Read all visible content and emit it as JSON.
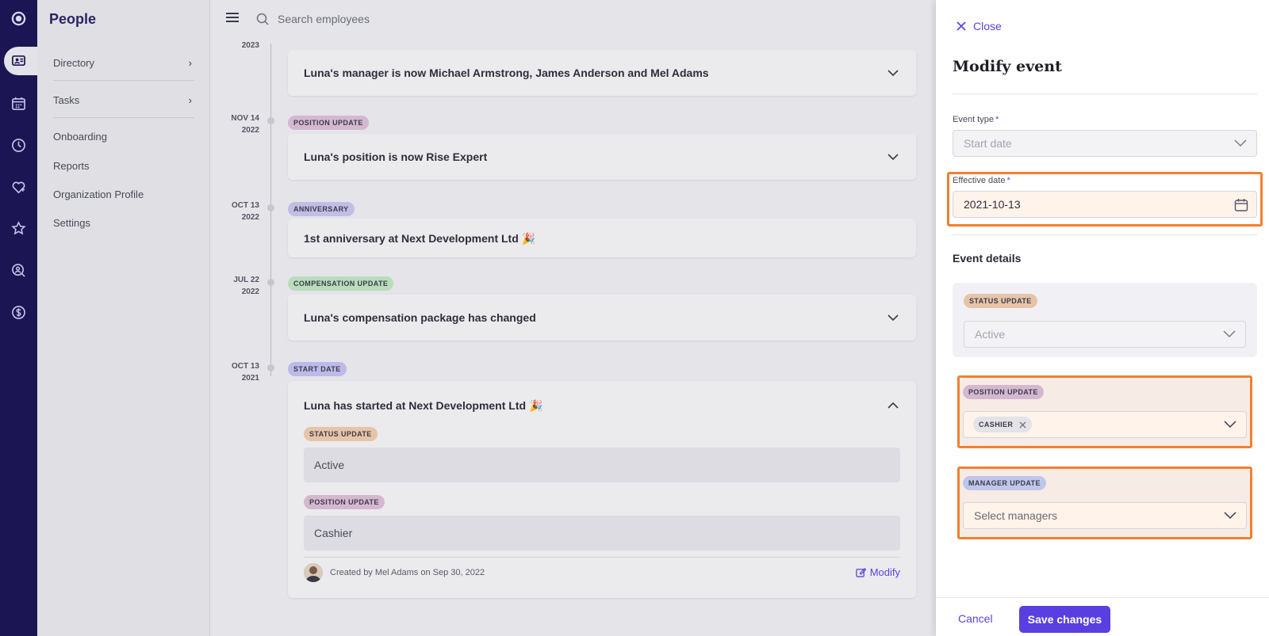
{
  "app": {
    "title": "People"
  },
  "rail": {
    "icons": [
      "logo-icon",
      "people-icon",
      "calendar-icon",
      "clock-icon",
      "heart-icon",
      "star-icon",
      "search-person-icon",
      "dollar-icon"
    ]
  },
  "sidebar": {
    "items": [
      {
        "label": "Directory",
        "has_arrow": true
      },
      {
        "label": "Tasks",
        "has_arrow": true
      },
      {
        "label": "Onboarding"
      },
      {
        "label": "Reports"
      },
      {
        "label": "Organization Profile"
      },
      {
        "label": "Settings"
      }
    ]
  },
  "search": {
    "placeholder": "Search employees"
  },
  "timeline": {
    "partial_year": "2023",
    "events": [
      {
        "title": "Luna's manager is now Michael Armstrong, James Anderson and Mel Adams"
      },
      {
        "date_md": "NOV 14",
        "date_y": "2022",
        "badge": "POSITION UPDATE",
        "title": "Luna's position is now Rise Expert"
      },
      {
        "date_md": "OCT 13",
        "date_y": "2022",
        "badge": "ANNIVERSARY",
        "title": "1st anniversary at Next Development Ltd 🎉"
      },
      {
        "date_md": "JUL 22",
        "date_y": "2022",
        "badge": "COMPENSATION UPDATE",
        "title": "Luna's compensation package has changed"
      },
      {
        "date_md": "OCT 13",
        "date_y": "2021",
        "badge": "START DATE",
        "title": "Luna has started at Next Development Ltd 🎉",
        "status_badge": "STATUS UPDATE",
        "status_value": "Active",
        "position_badge": "POSITION UPDATE",
        "position_value": "Cashier",
        "created_by": "Created by Mel Adams on Sep 30, 2022",
        "modify_label": "Modify"
      }
    ]
  },
  "drawer": {
    "close_label": "Close",
    "title": "Modify event",
    "event_type_label": "Event type",
    "required_mark": "*",
    "event_type_value": "Start date",
    "effective_date_label": "Effective date",
    "effective_date_value": "2021-10-13",
    "event_details_label": "Event details",
    "status_badge": "STATUS UPDATE",
    "status_value": "Active",
    "position_badge": "POSITION UPDATE",
    "position_chip": "CASHIER",
    "manager_badge": "MANAGER UPDATE",
    "manager_placeholder": "Select managers",
    "cancel_label": "Cancel",
    "save_label": "Save changes",
    "highlight_color": "#f47f2e",
    "accent_color": "#5a3fe0"
  }
}
